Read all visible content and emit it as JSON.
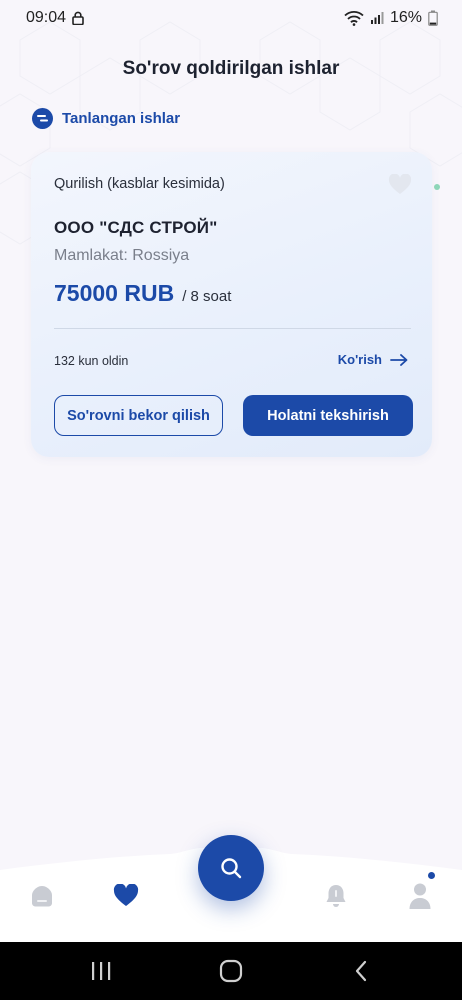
{
  "status_bar": {
    "time": "09:04",
    "battery": "16%"
  },
  "page": {
    "title": "So'rov qoldirilgan ishlar"
  },
  "filter_chip": {
    "label": "Tanlangan ishlar"
  },
  "card": {
    "category": "Qurilish (kasblar kesimida)",
    "company": "ООО \"СДС СТРОЙ\"",
    "country": "Mamlakat: Rossiya",
    "price": "75000 RUB",
    "unit": "/ 8 soat",
    "posted_ago": "132 kun oldin",
    "view_label": "Ko'rish",
    "cancel_button": "So'rovni bekor qilish",
    "check_button": "Holatni tekshirish"
  },
  "bottom_nav": {
    "items": [
      "home-icon",
      "heart-icon",
      "search-icon",
      "bell-icon",
      "user-icon"
    ],
    "active": "heart-icon",
    "has_profile_notification": true
  },
  "colors": {
    "accent": "#1c4aa8",
    "background": "#f8f6fb",
    "card_bg": "#eaf0fc",
    "muted": "#7a7f8b"
  }
}
